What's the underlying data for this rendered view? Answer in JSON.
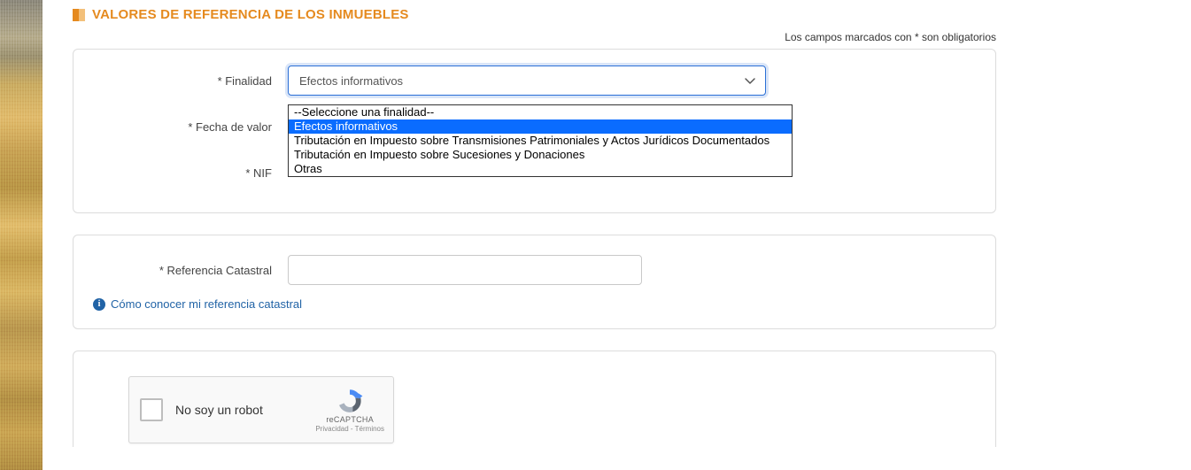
{
  "page": {
    "title": "VALORES DE REFERENCIA DE LOS INMUEBLES",
    "required_note": "Los campos marcados con * son obligatorios"
  },
  "form": {
    "finalidad": {
      "label": "* Finalidad",
      "selected": "Efectos informativos",
      "options": [
        "--Seleccione una finalidad--",
        "Efectos informativos",
        "Tributación en Impuesto sobre Transmisiones Patrimoniales y Actos Jurídicos Documentados",
        "Tributación en Impuesto sobre Sucesiones y Donaciones",
        "Otras"
      ],
      "highlighted_index": 1
    },
    "fecha_valor": {
      "label": "* Fecha de valor"
    },
    "nif": {
      "label": "* NIF"
    },
    "ref_catastral": {
      "label": "* Referencia Catastral",
      "value": ""
    },
    "help_link": "Cómo conocer mi referencia catastral"
  },
  "captcha": {
    "label": "No soy un robot",
    "brand": "reCAPTCHA",
    "legal": "Privacidad - Términos"
  }
}
